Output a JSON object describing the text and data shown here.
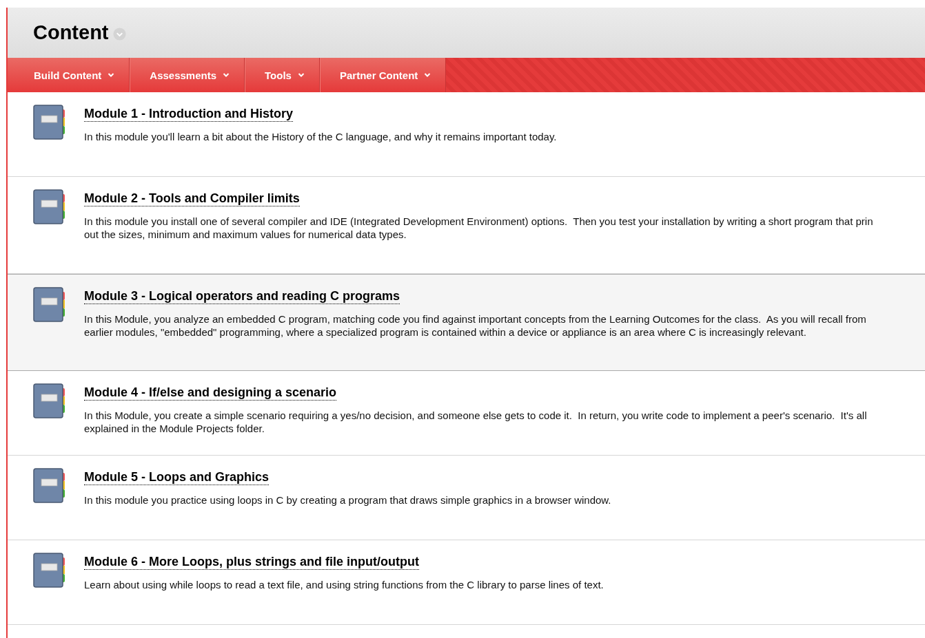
{
  "page_title": "Content",
  "menu": [
    {
      "label": "Build Content"
    },
    {
      "label": "Assessments"
    },
    {
      "label": "Tools"
    },
    {
      "label": "Partner Content"
    }
  ],
  "modules": [
    {
      "title": "Module 1 - Introduction and History",
      "selected": false,
      "description_lines": [
        "In this module you'll learn a bit about the History of the C language, and why it remains important today."
      ]
    },
    {
      "title": "Module 2 - Tools and Compiler limits",
      "selected": false,
      "description_lines": [
        "In this module you install one of several compiler and IDE (Integrated Development Environment) options.  Then you test your installation by writing a short program that prin",
        "out the sizes, minimum and maximum values for numerical data types."
      ]
    },
    {
      "title": "Module 3 - Logical operators and reading C programs",
      "selected": true,
      "description_lines": [
        "In this Module, you analyze an embedded C program, matching code you find against important concepts from the Learning Outcomes for the class.  As you will recall from",
        "earlier modules, \"embedded\" programming, where a specialized program is contained within a device or appliance is an area where C is increasingly relevant."
      ]
    },
    {
      "title": "Module 4 - If/else and designing a scenario",
      "selected": false,
      "description_lines": [
        "In this Module, you create a simple scenario requiring a yes/no decision, and someone else gets to code it.  In return, you write code to implement a peer's scenario.  It's all",
        "explained in the Module Projects folder."
      ]
    },
    {
      "title": "Module 5 - Loops and Graphics",
      "selected": false,
      "description_lines": [
        "In this module you practice using loops in C by creating a program that draws simple graphics in a browser window."
      ]
    },
    {
      "title": "Module 6 - More Loops, plus strings and file input/output",
      "selected": false,
      "description_lines": [
        "Learn about using while loops to read a text file, and using string functions from the C library to parse lines of text."
      ]
    }
  ]
}
